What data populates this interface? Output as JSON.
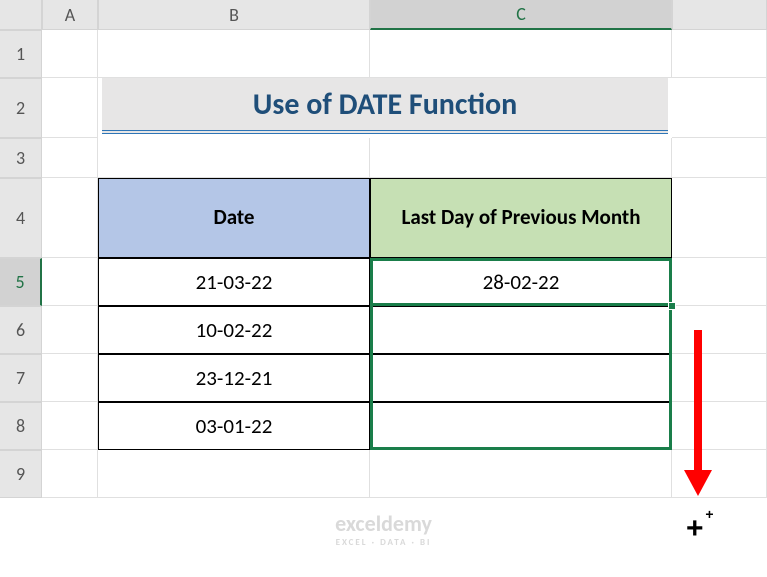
{
  "columns": [
    "A",
    "B",
    "C"
  ],
  "rows": [
    "1",
    "2",
    "3",
    "4",
    "5",
    "6",
    "7",
    "8",
    "9"
  ],
  "active_col": "C",
  "active_row": "5",
  "title": "Use of DATE Function",
  "headers": {
    "date": "Date",
    "last": "Last Day of Previous Month"
  },
  "data": [
    {
      "date": "21-03-22",
      "last": "28-02-22"
    },
    {
      "date": "10-02-22",
      "last": ""
    },
    {
      "date": "23-12-21",
      "last": ""
    },
    {
      "date": "03-01-22",
      "last": ""
    }
  ],
  "watermark": {
    "line1": "exceldemy",
    "line2": "EXCEL · DATA · BI"
  },
  "chart_data": {
    "type": "table",
    "title": "Use of DATE Function",
    "columns": [
      "Date",
      "Last Day of Previous Month"
    ],
    "rows": [
      [
        "21-03-22",
        "28-02-22"
      ],
      [
        "10-02-22",
        ""
      ],
      [
        "23-12-21",
        ""
      ],
      [
        "03-01-22",
        ""
      ]
    ]
  }
}
